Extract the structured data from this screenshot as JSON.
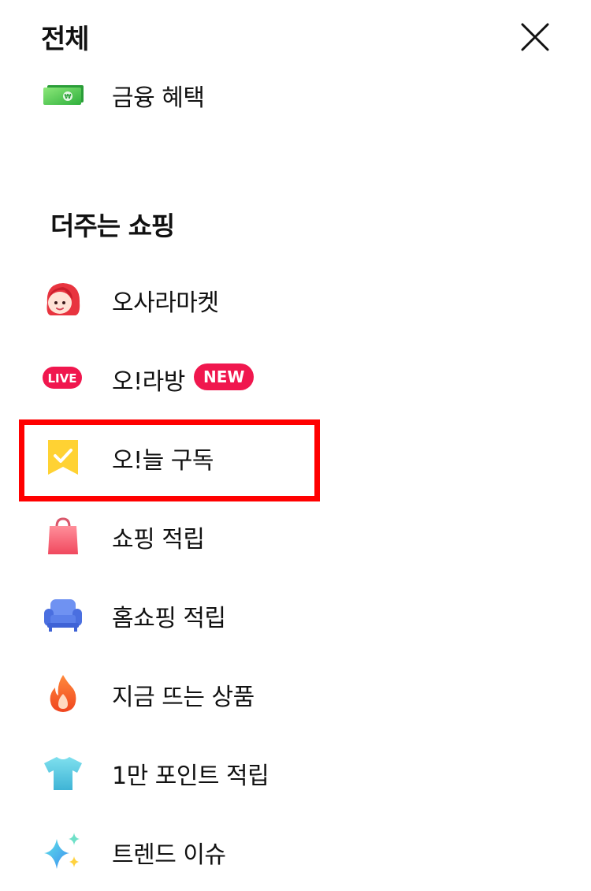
{
  "header": {
    "title": "전체",
    "close_icon": "close-icon"
  },
  "top_items": [
    {
      "label": "금융 혜택",
      "icon": "money-bill-icon"
    }
  ],
  "section": {
    "title": "더주는 쇼핑",
    "items": [
      {
        "label": "오사라마켓",
        "icon": "avatar-girl-icon"
      },
      {
        "label": "오!라방",
        "icon": "live-icon",
        "icon_text": "LIVE",
        "badge": "NEW"
      },
      {
        "label": "오!늘 구독",
        "icon": "check-ribbon-icon"
      },
      {
        "label": "쇼핑 적립",
        "icon": "shopping-bag-icon"
      },
      {
        "label": "홈쇼핑 적립",
        "icon": "sofa-icon"
      },
      {
        "label": "지금 뜨는 상품",
        "icon": "fire-icon"
      },
      {
        "label": "1만 포인트 적립",
        "icon": "tshirt-icon"
      },
      {
        "label": "트렌드 이슈",
        "icon": "sparkle-icon"
      }
    ]
  },
  "colors": {
    "badge": "#f0174e",
    "highlight": "#ff0000"
  }
}
